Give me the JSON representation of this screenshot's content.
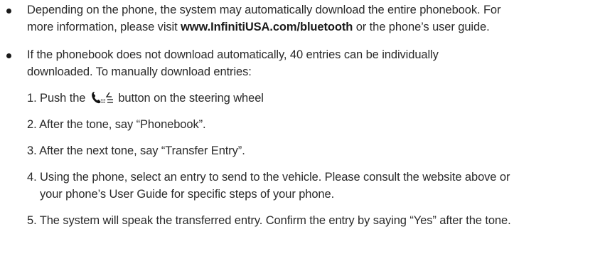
{
  "bullets": [
    {
      "line1": "Depending on the phone, the system may automatically download the entire phonebook. For",
      "line2_pre": "more information, please visit ",
      "link": "www.InfinitiUSA.com/bluetooth",
      "line2_post": " or the phone’s user guide."
    },
    {
      "line1": "If the phonebook does not download automatically, 40 entries can be individually",
      "line2": "downloaded. To manually download entries:"
    }
  ],
  "steps": {
    "s1_pre": "1. Push the ",
    "s1_post": " button on the steering wheel",
    "s2": "2. After the tone, say “Phonebook”.",
    "s3": "3. After the next tone, say “Transfer Entry”.",
    "s4_line1": "4. Using the phone, select an entry to send to the vehicle. Please consult the website above or",
    "s4_line2": "your phone’s User Guide for specific steps of your phone.",
    "s5": "5. The system will speak the transferred entry. Confirm the entry by saying “Yes” after the tone."
  },
  "icons": {
    "steering_phone_button": "phone-voice-icon"
  }
}
